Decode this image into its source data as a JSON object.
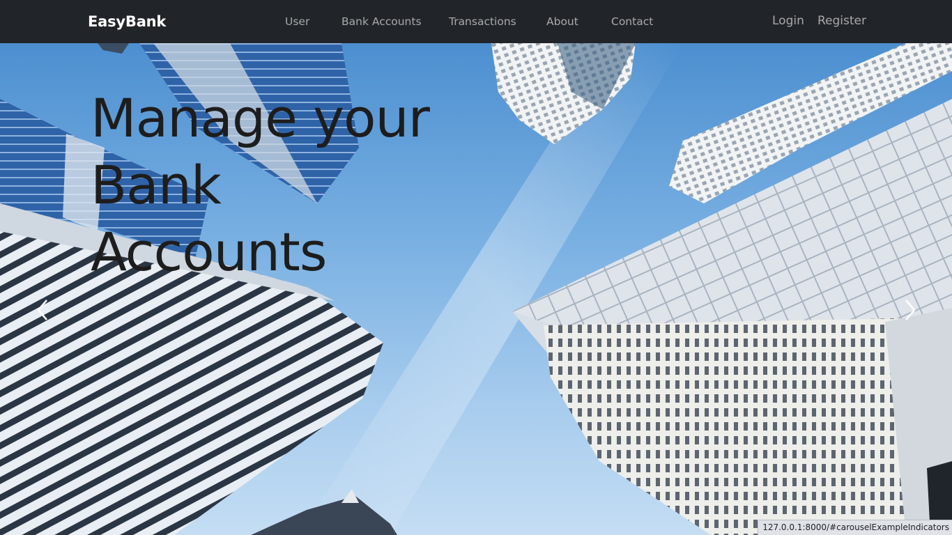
{
  "navbar": {
    "brand": "EasyBank",
    "links": [
      "User",
      "Bank Accounts",
      "Transactions",
      "About",
      "Contact"
    ],
    "auth": [
      "Login",
      "Register"
    ]
  },
  "hero": {
    "headline": "Manage your Bank Accounts",
    "prev_icon": "chevron-left-icon",
    "next_icon": "chevron-right-icon"
  },
  "status_bar": {
    "url": "127.0.0.1:8000/#carouselExampleIndicators"
  },
  "colors": {
    "navbar_bg": "#212529",
    "brand_text": "#ffffff",
    "nav_text": "rgba(255,255,255,0.6)",
    "headline_text": "#1d1d1d",
    "sky": "#79b0e2"
  }
}
